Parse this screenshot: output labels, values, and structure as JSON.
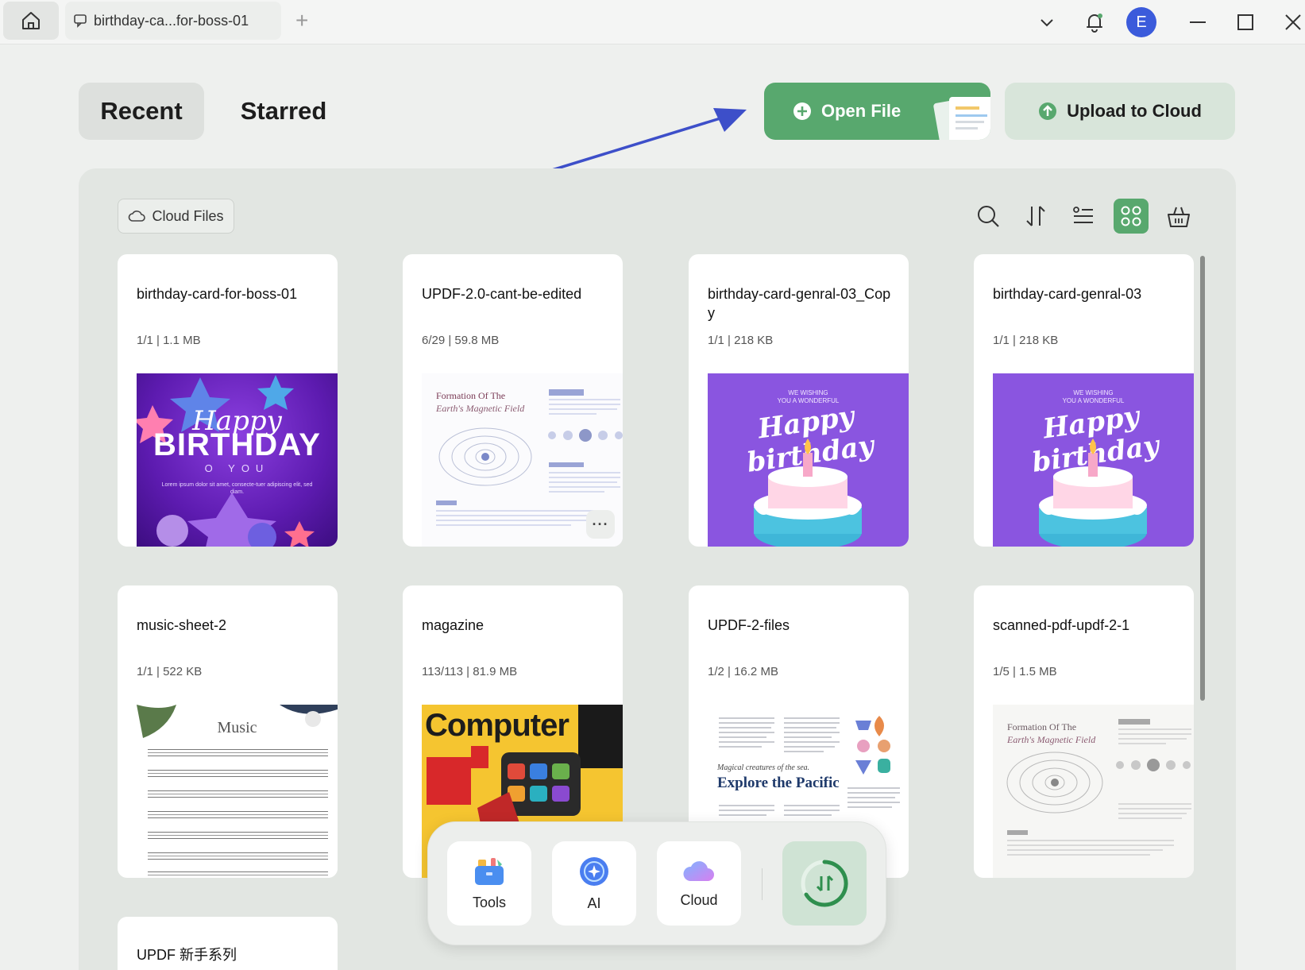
{
  "titlebar": {
    "tab_title": "birthday-ca...for-boss-01",
    "avatar_letter": "E"
  },
  "nav": {
    "recent": "Recent",
    "starred": "Starred"
  },
  "actions": {
    "open_file": "Open File",
    "upload_to_cloud": "Upload to Cloud"
  },
  "panel": {
    "cloud_files": "Cloud Files",
    "accent": "#58a86e"
  },
  "files": [
    {
      "name": "birthday-card-for-boss-01",
      "meta": "1/1 | 1.1 MB"
    },
    {
      "name": "UPDF-2.0-cant-be-edited",
      "meta": "6/29 | 59.8 MB"
    },
    {
      "name": "birthday-card-genral-03_Copy",
      "meta": "1/1 | 218 KB"
    },
    {
      "name": "birthday-card-genral-03",
      "meta": "1/1 | 218 KB"
    },
    {
      "name": "music-sheet-2",
      "meta": "1/1 | 522 KB"
    },
    {
      "name": "magazine",
      "meta": "113/113 | 81.9 MB"
    },
    {
      "name": "UPDF-2-files",
      "meta": "1/2 | 16.2 MB"
    },
    {
      "name": "scanned-pdf-updf-2-1",
      "meta": "1/5 | 1.5 MB"
    },
    {
      "name": "UPDF 新手系列",
      "meta": ""
    }
  ],
  "thumbs": {
    "happy": "Happy",
    "birthday_caps": "BIRTHDAY",
    "to_you": "O YOU",
    "lorem": "Lorem ipsum dolor sit amet, consecte-tuer adipiscing elit, sed diam.",
    "wish_line1": "WE WISHING",
    "wish_line2": "YOU A WONDERFUL",
    "happy_birthday_script": "Happy birthday",
    "doc_title_line1": "Formation Of The",
    "doc_title_line2": "Earth's Magnetic Field",
    "music_title": "Music",
    "magazine_title": "Computer",
    "pacific_small": "Magical creatures of the sea.",
    "pacific_title": "Explore the Pacific"
  },
  "dock": {
    "tools": "Tools",
    "ai": "AI",
    "cloud": "Cloud"
  }
}
